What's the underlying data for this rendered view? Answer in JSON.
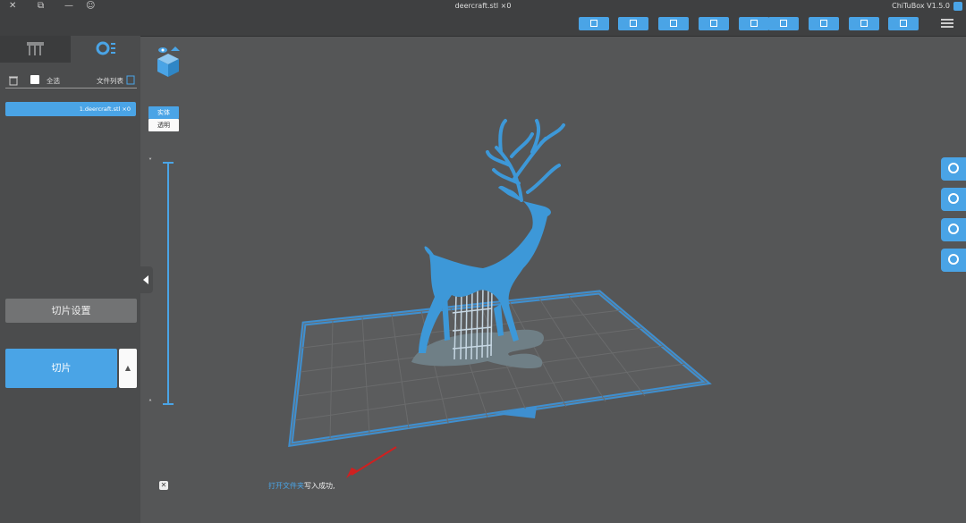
{
  "window": {
    "title": "deercraft.stl ×0",
    "app_name": "ChiTuBox V1.5.0"
  },
  "toolbar": {
    "buttons": [
      "open-file-icon",
      "save-icon",
      "export-icon",
      "settings-icon",
      "import-icon",
      "copy-icon",
      "layout-icon",
      "support-icon",
      "hollow-icon",
      "slice-icon"
    ]
  },
  "left_panel": {
    "tabs": [
      "settings-tab",
      "platform-tab"
    ],
    "header": {
      "file_list_label": "文件列表",
      "select_all_label": "全选"
    },
    "files": [
      {
        "name": "1.deercraft.stl ×0"
      }
    ],
    "slice_settings_label": "切片设置",
    "slice_label": "切片",
    "slice_dropdown": "▲"
  },
  "viewport": {
    "view_buttons": {
      "solid": "实体",
      "transparent": "透明"
    },
    "layer_slider": {
      "top_chevron": "˅",
      "bottom_chevron": "˄"
    },
    "status_text": "写入成功,",
    "status_link": "打开文件夹",
    "accent": "#4aa4e6",
    "model": "deer"
  }
}
